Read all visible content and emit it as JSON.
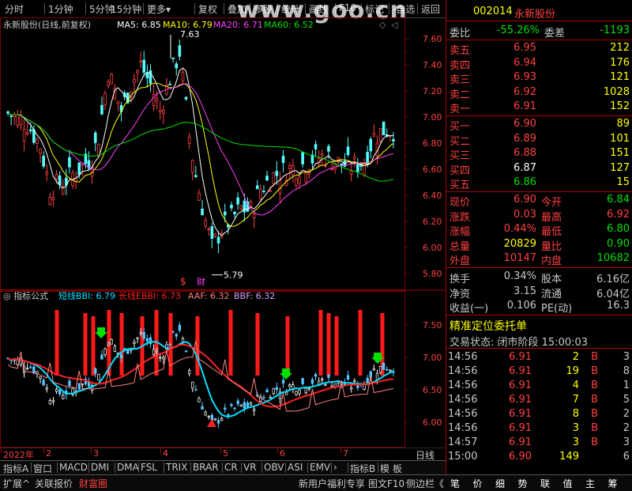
{
  "toolbar": {
    "items": [
      "分时",
      "1分钟",
      "5分钟",
      "15分钟",
      "更多▾",
      "复权",
      "叠加",
      "多股",
      "统计",
      "画线",
      "F10",
      "标记",
      "-自选",
      "返回"
    ]
  },
  "watermark": "www.goo.cn",
  "chart": {
    "title": "永新股份(日线,前复权)",
    "ma_labels": {
      "ma5": "MA5: 6.85",
      "ma10": "MA10: 6.79",
      "ma20": "MA20: 6.71",
      "ma60": "MA60: 6.52"
    },
    "price_ticks": [
      "7.60",
      "7.40",
      "7.20",
      "7.00",
      "6.80",
      "6.60",
      "6.40",
      "6.20",
      "6.00",
      "5.80"
    ],
    "high_label": "7.63",
    "low_label": "5.79",
    "events": [
      "$",
      "财"
    ],
    "colors": {
      "ma5": "#ffffff",
      "ma10": "#ffff00",
      "ma20": "#ff40ff",
      "ma60": "#00e000",
      "up": "#ff4040",
      "down": "#54ffff",
      "grid": "#7a0000"
    }
  },
  "indicator": {
    "title": "指标公式",
    "labels": {
      "short": "短线BBI: 6.79",
      "long": "长线EBBI: 6.73",
      "aaf": "AAF: 6.32",
      "bbf": "BBF: 6.32"
    },
    "ticks": [
      "7.50",
      "7.00",
      "6.50",
      "6.00"
    ],
    "colors": {
      "short": "#00e0ff",
      "long": "#ff2020",
      "aaf": "#ff8080",
      "bbf": "#e0a0ff"
    }
  },
  "xaxis": {
    "labels": [
      "2022年",
      "2",
      "3",
      "4",
      "5",
      "6",
      "7"
    ],
    "right_label": "日线"
  },
  "tabs": [
    "指标A",
    "窗口",
    "MACD",
    "DMI",
    "DMA",
    "FSL",
    "TRIX",
    "BRAR",
    "CR",
    "VR",
    "OBV",
    "ASI",
    "EMV",
    "›",
    "指标B",
    "模",
    "板"
  ],
  "bottom": {
    "left": [
      "扩展^",
      "关联报价",
      "财富圈"
    ],
    "right": [
      "新用户福利专享",
      "图文F10",
      "侧边栏《"
    ],
    "icons": [
      "笔",
      "价",
      "细",
      "势",
      "联",
      "值",
      "主",
      "筹"
    ]
  },
  "quote": {
    "code": "002014",
    "name": "永新股份",
    "weibi_label": "委比",
    "weibi": "-55.26%",
    "weicha_label": "委差",
    "weicha": "-1193",
    "asks": [
      {
        "label": "卖五",
        "price": "6.95",
        "vol": "212"
      },
      {
        "label": "卖四",
        "price": "6.94",
        "vol": "176"
      },
      {
        "label": "卖三",
        "price": "6.93",
        "vol": "121"
      },
      {
        "label": "卖二",
        "price": "6.92",
        "vol": "1028"
      },
      {
        "label": "卖一",
        "price": "6.91",
        "vol": "152"
      }
    ],
    "bids": [
      {
        "label": "买一",
        "price": "6.90",
        "vol": "89"
      },
      {
        "label": "买二",
        "price": "6.89",
        "vol": "101"
      },
      {
        "label": "买三",
        "price": "6.88",
        "vol": "151"
      },
      {
        "label": "买四",
        "price": "6.87",
        "vol": "127"
      },
      {
        "label": "买五",
        "price": "6.86",
        "vol": "15"
      }
    ],
    "stats": [
      {
        "l1": "现价",
        "v1": "6.90",
        "l2": "今开",
        "v2": "6.84"
      },
      {
        "l1": "涨跌",
        "v1": "0.03",
        "l2": "最高",
        "v2": "6.92"
      },
      {
        "l1": "涨幅",
        "v1": "0.44%",
        "l2": "最低",
        "v2": "6.80"
      },
      {
        "l1": "总量",
        "v1": "20829",
        "l2": "量比",
        "v2": "0.90"
      },
      {
        "l1": "外盘",
        "v1": "10147",
        "l2": "内盘",
        "v2": "10682"
      }
    ],
    "stats2": [
      {
        "l1": "换手",
        "v1": "0.34%",
        "l2": "股本",
        "v2": "6.16亿"
      },
      {
        "l1": "净资",
        "v1": "3.15",
        "l2": "流通",
        "v2": "6.04亿"
      },
      {
        "l1": "收益(一)",
        "v1": "0.106",
        "l2": "PE(动)",
        "v2": "16.3"
      }
    ],
    "section_title": "精准定位委托单",
    "status": "交易状态: 闭市阶段 15:00:03",
    "trades": [
      {
        "t": "14:56",
        "p": "6.91",
        "v": "2",
        "bs": "B",
        "n": "3"
      },
      {
        "t": "14:56",
        "p": "6.91",
        "v": "19",
        "bs": "B",
        "n": "8"
      },
      {
        "t": "14:56",
        "p": "6.91",
        "v": "4",
        "bs": "B",
        "n": "1"
      },
      {
        "t": "14:56",
        "p": "6.91",
        "v": "7",
        "bs": "B",
        "n": "5"
      },
      {
        "t": "14:56",
        "p": "6.91",
        "v": "8",
        "bs": "B",
        "n": "2"
      },
      {
        "t": "14:56",
        "p": "6.91",
        "v": "3",
        "bs": "B",
        "n": "2"
      },
      {
        "t": "14:57",
        "p": "6.91",
        "v": "3",
        "bs": "B",
        "n": "3"
      },
      {
        "t": "15:00",
        "p": "6.90",
        "v": "149",
        "bs": "",
        "n": "6"
      }
    ]
  }
}
